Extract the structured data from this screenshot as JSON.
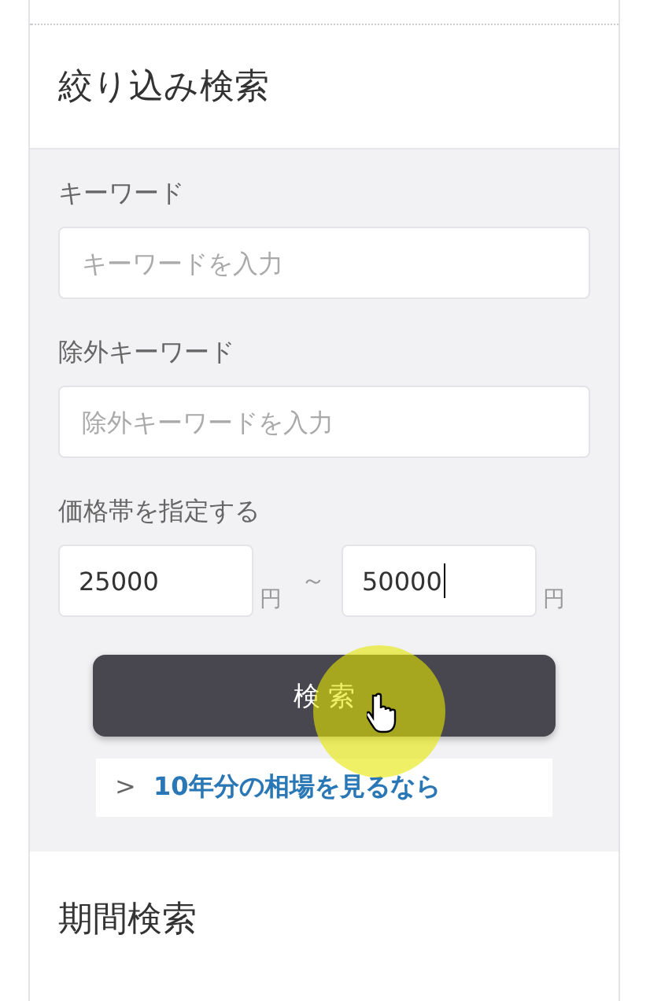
{
  "panel": {
    "title": "絞り込み検索",
    "fields": [
      {
        "kind": "text",
        "label": "キーワード",
        "placeholder": "キーワードを入力"
      },
      {
        "kind": "text",
        "label": "除外キーワード",
        "placeholder": "除外キーワードを入力"
      },
      {
        "kind": "range",
        "label": "価格帯を指定する",
        "min": {
          "value": "25000",
          "unit": "円",
          "focused": false
        },
        "separator": "～",
        "max": {
          "value": "50000",
          "unit": "円",
          "focused": true
        }
      }
    ],
    "search_button": "検 索",
    "link": {
      "arrow": ">",
      "text": "10年分の相場を見るなら"
    },
    "cursor": {
      "click_highlight": true
    }
  },
  "next_section": {
    "title": "期間検索"
  }
}
